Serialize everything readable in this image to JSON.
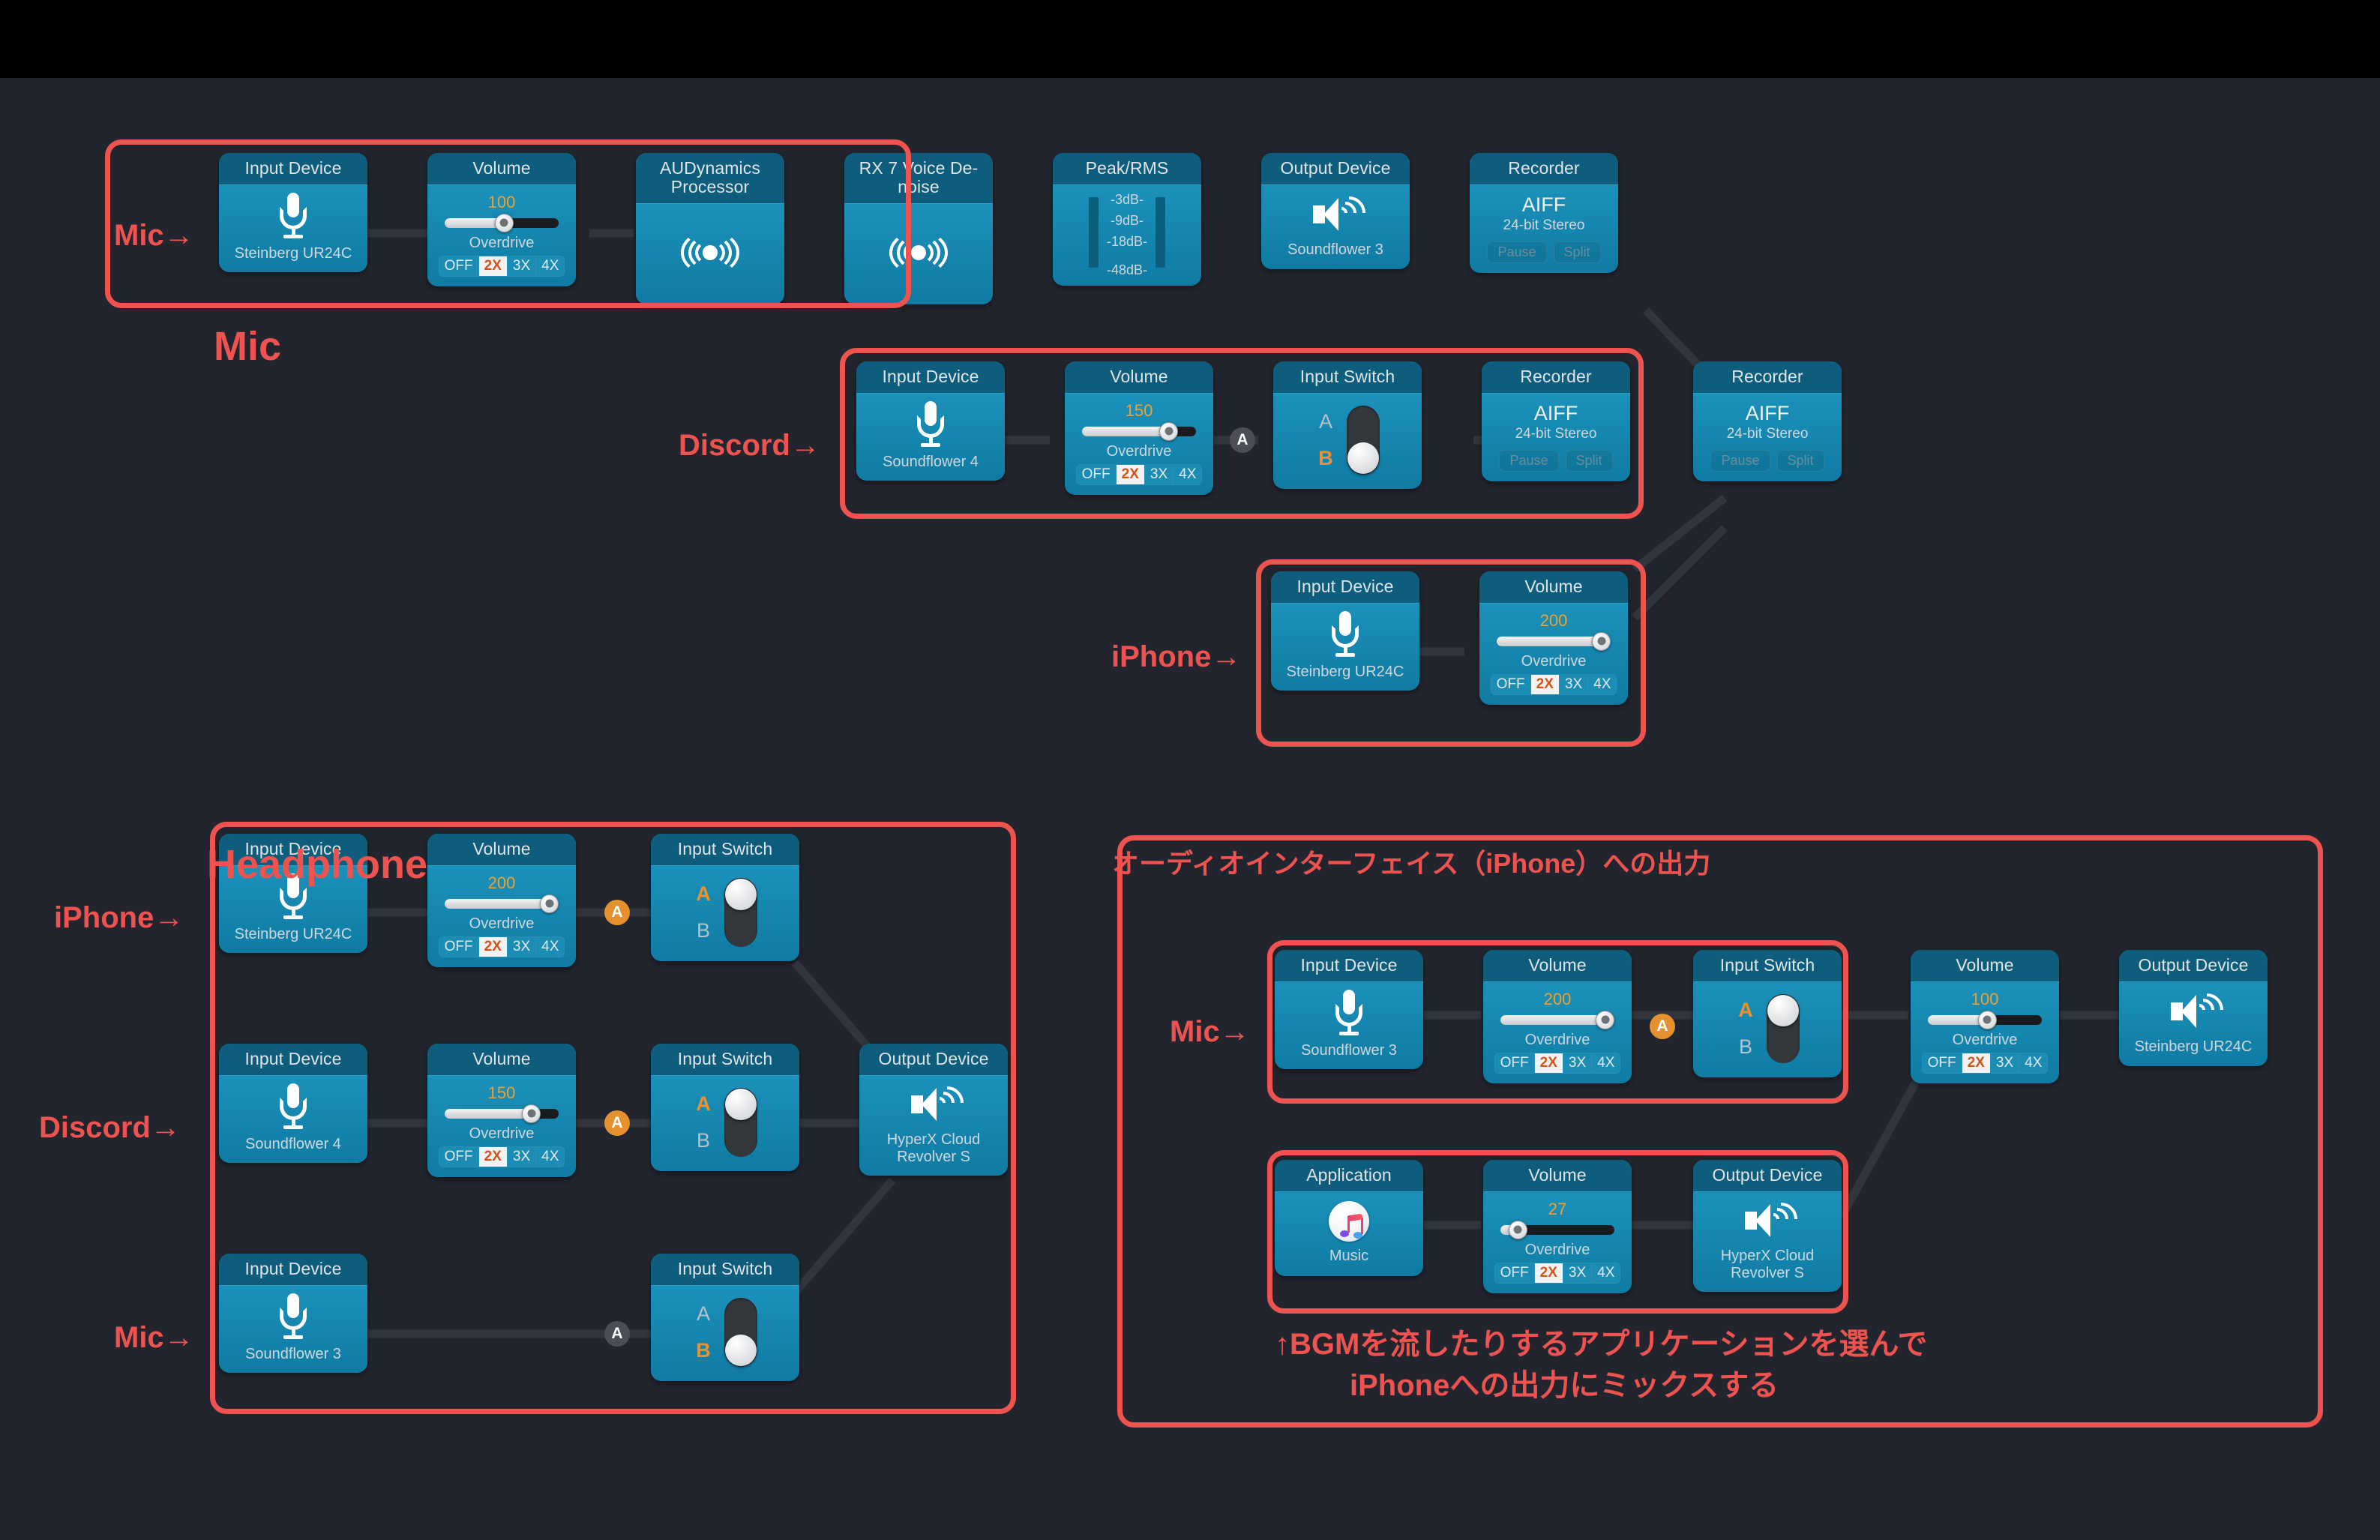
{
  "labels": {
    "mic_title": "Mic",
    "headphone_title": "Headphone",
    "mic_arrow": "Mic→",
    "discord_arrow": "Discord→",
    "iphone_arrow": "iPhone→",
    "jp_iphone_output": "オーディオインターフェイス（iPhone）への出力",
    "jp_bgm_line1": "↑BGMを流したりするアプリケーションを選んで",
    "jp_bgm_line2": "iPhoneへの出力にミックスする"
  },
  "colors": {
    "accent_red": "#ef5350",
    "node_blue": "#1287b0",
    "node_header_blue": "#0e5d7c",
    "value_orange": "#f0a030",
    "canvas_bg": "#22252e"
  },
  "headers": {
    "input_device": "Input Device",
    "output_device": "Output Device",
    "volume": "Volume",
    "audynamics": "AUDynamics Processor",
    "rx7": "RX 7 Voice De-noise",
    "peak_rms": "Peak/RMS",
    "recorder": "Recorder",
    "input_switch": "Input Switch",
    "application": "Application"
  },
  "devices": {
    "steinberg": "Steinberg UR24C",
    "soundflower3": "Soundflower 3",
    "soundflower4": "Soundflower 4",
    "hyperx": "HyperX Cloud Revolver S",
    "music": "Music"
  },
  "overdrive": {
    "label": "Overdrive",
    "options": [
      "OFF",
      "2X",
      "3X",
      "4X"
    ],
    "selected": "2X"
  },
  "meter": {
    "ticks": [
      "-3dB-",
      "-9dB-",
      "-18dB-",
      "-48dB-"
    ]
  },
  "recorder": {
    "format": "AIFF",
    "depth": "24-bit Stereo",
    "pause": "Pause",
    "split": "Split"
  },
  "switch": {
    "a": "A",
    "b": "B"
  },
  "volumes": {
    "mic_chain": "100",
    "discord_chain": "150",
    "iphone_in": "200",
    "hp_iphone": "200",
    "hp_discord": "150",
    "out_mic": "200",
    "out_post": "100",
    "out_music": "27"
  },
  "badges": {
    "mic_gray": "A",
    "discord_gray": "A",
    "hp_iphone_orange": "A",
    "hp_discord_orange": "A",
    "hp_mic_gray": "A",
    "out_mic_orange": "A"
  }
}
